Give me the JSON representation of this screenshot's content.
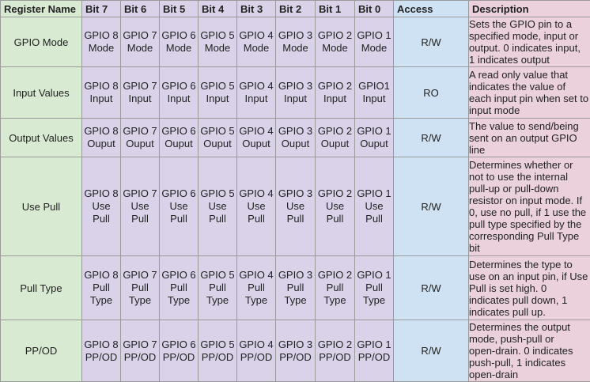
{
  "colors": {
    "name_col": "#d9ead3",
    "bits_col": "#d9d2e9",
    "access_col": "#cfe2f3",
    "desc_col": "#ead1dc",
    "border": "#9a9a9a"
  },
  "headers": [
    "Register Name",
    "Bit 7",
    "Bit 6",
    "Bit 5",
    "Bit 4",
    "Bit 3",
    "Bit 2",
    "Bit 1",
    "Bit 0",
    "Access",
    "Description"
  ],
  "rows": [
    {
      "name": "GPIO Mode",
      "bits": [
        [
          "GPIO 8",
          "Mode"
        ],
        [
          "GPIO 7",
          "Mode"
        ],
        [
          "GPIO 6",
          "Mode"
        ],
        [
          "GPIO 5",
          "Mode"
        ],
        [
          "GPIO 4",
          "Mode"
        ],
        [
          "GPIO 3",
          "Mode"
        ],
        [
          "GPIO 2",
          "Mode"
        ],
        [
          "GPIO 1",
          "Mode"
        ]
      ],
      "access": "R/W",
      "description": [
        "Sets the GPIO pin to a",
        "specified mode, input or",
        "output. 0 indicates input,",
        "1 indicates output"
      ]
    },
    {
      "name": "Input Values",
      "bits": [
        [
          "GPIO 8",
          "Input"
        ],
        [
          "GPIO 7",
          "Input"
        ],
        [
          "GPIO 6",
          "Input"
        ],
        [
          "GPIO 5",
          "Input"
        ],
        [
          "GPIO 4",
          "Input"
        ],
        [
          "GPIO 3",
          "Input"
        ],
        [
          "GPIO 2",
          "Input"
        ],
        [
          "GPIO1",
          "Input"
        ]
      ],
      "access": "RO",
      "description": [
        "A read only value that",
        "indicates the value of",
        "each input pin when set to",
        "input mode"
      ]
    },
    {
      "name": "Output Values",
      "bits": [
        [
          "GPIO 8",
          "Ouput"
        ],
        [
          "GPIO 7",
          "Ouput"
        ],
        [
          "GPIO 6",
          "Ouput"
        ],
        [
          "GPIO 5",
          "Ouput"
        ],
        [
          "GPIO 4",
          "Ouput"
        ],
        [
          "GPIO 3",
          "Ouput"
        ],
        [
          "GPIO 2",
          "Ouput"
        ],
        [
          "GPIO 1",
          "Ouput"
        ]
      ],
      "access": "R/W",
      "description": [
        "The value to send/being",
        "sent on an output GPIO",
        "line"
      ]
    },
    {
      "name": "Use Pull",
      "bits": [
        [
          "GPIO 8",
          "Use",
          "Pull"
        ],
        [
          "GPIO 7",
          "Use",
          "Pull"
        ],
        [
          "GPIO 6",
          "Use",
          "Pull"
        ],
        [
          "GPIO 5",
          "Use",
          "Pull"
        ],
        [
          "GPIO 4",
          "Use",
          "Pull"
        ],
        [
          "GPIO 3",
          "Use",
          "Pull"
        ],
        [
          "GPIO 2",
          "Use",
          "Pull"
        ],
        [
          "GPIO 1",
          "Use",
          "Pull"
        ]
      ],
      "access": "R/W",
      "description": [
        "Determines whether or",
        "not to use the internal",
        "pull-up or pull-down",
        "resistor on input mode. If",
        "0, use no pull, if 1 use the",
        "pull type specified by the",
        "corresponding Pull Type",
        "bit"
      ]
    },
    {
      "name": "Pull Type",
      "bits": [
        [
          "GPIO 8",
          "Pull",
          "Type"
        ],
        [
          "GPIO 7",
          "Pull",
          "Type"
        ],
        [
          "GPIO 6",
          "Pull",
          "Type"
        ],
        [
          "GPIO 5",
          "Pull",
          "Type"
        ],
        [
          "GPIO 4",
          "Pull",
          "Type"
        ],
        [
          "GPIO 3",
          "Pull",
          "Type"
        ],
        [
          "GPIO 2",
          "Pull",
          "Type"
        ],
        [
          "GPIO 1",
          "Pull",
          "Type"
        ]
      ],
      "access": "R/W",
      "description": [
        "Determines the type to",
        "use on an input pin, if Use",
        "Pull is set high. 0",
        "indicates pull down, 1",
        "indicates pull up."
      ]
    },
    {
      "name": "PP/OD",
      "bits": [
        [
          "GPIO 8",
          "PP/OD"
        ],
        [
          "GPIO 7",
          "PP/OD"
        ],
        [
          "GPIO 6",
          "PP/OD"
        ],
        [
          "GPIO 5",
          "PP/OD"
        ],
        [
          "GPIO 4",
          "PP/OD"
        ],
        [
          "GPIO 3",
          "PP/OD"
        ],
        [
          "GPIO 2",
          "PP/OD"
        ],
        [
          "GPIO 1",
          "PP/OD"
        ]
      ],
      "access": "R/W",
      "description": [
        "Determines the output",
        "mode, push-pull or",
        "open-drain. 0 indicates",
        "push-pull, 1 indicates",
        "open-drain"
      ]
    }
  ]
}
